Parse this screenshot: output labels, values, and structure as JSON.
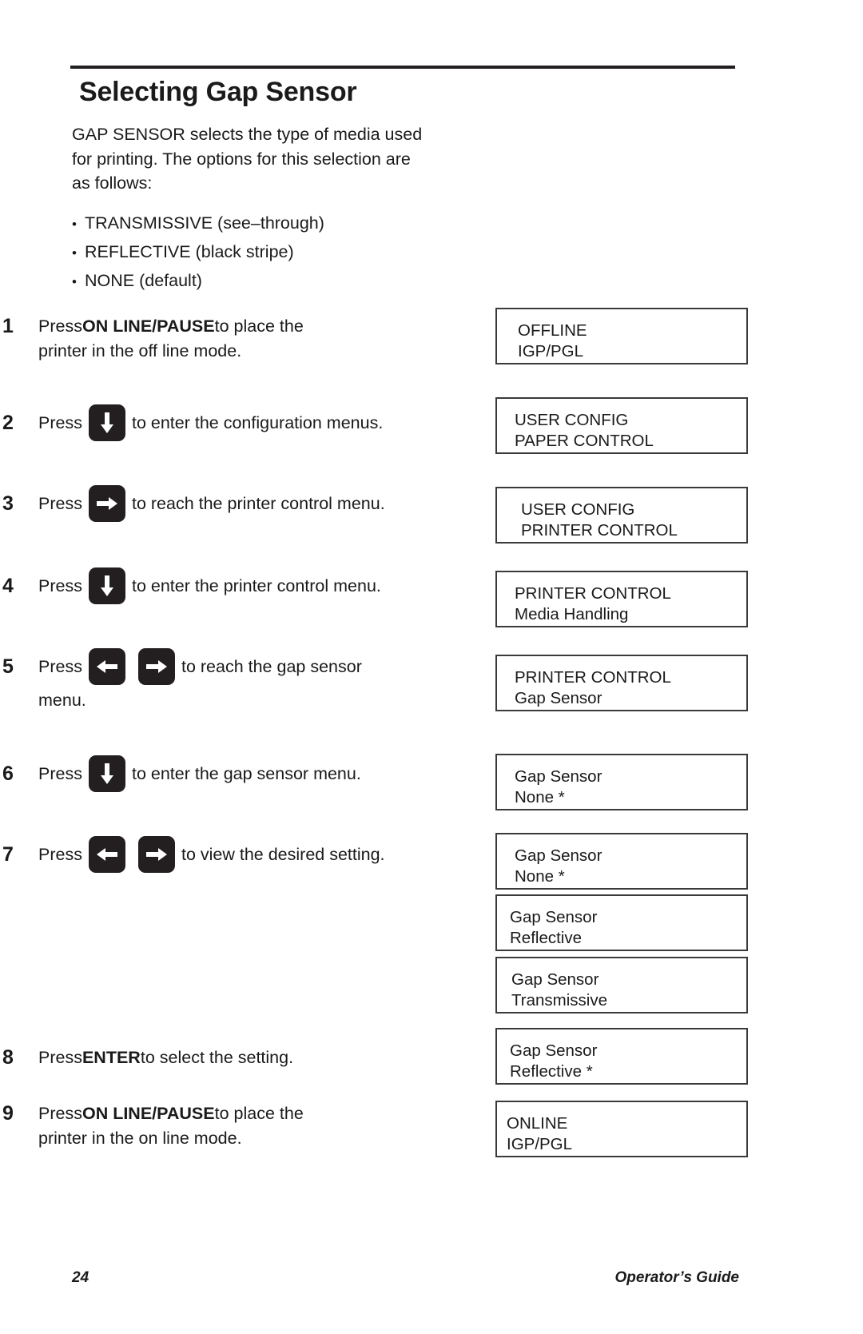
{
  "document": {
    "title": "Selecting Gap Sensor",
    "intro": "GAP SENSOR selects the type of media used for printing. The options for this selection are as follows:",
    "options": [
      {
        "bullet": "•",
        "text": "TRANSMISSIVE (see–through)"
      },
      {
        "bullet": "•",
        "text": "REFLECTIVE (black stripe)"
      },
      {
        "bullet": "•",
        "text": "NONE (default)"
      }
    ]
  },
  "steps": [
    {
      "number": "1",
      "line1_pre": "Press ",
      "line1_bold": "ON LINE/PAUSE",
      "line1_post": " to place the",
      "line2": "printer in the off line mode.",
      "keys": []
    },
    {
      "number": "2",
      "line1_pre": "Press ",
      "line1_post": "to enter the configuration menus.",
      "keys": [
        "arrow-down"
      ]
    },
    {
      "number": "3",
      "line1_pre": "Press ",
      "line1_post": "to reach the printer control menu.",
      "keys": [
        "arrow-right"
      ]
    },
    {
      "number": "4",
      "line1_pre": "Press ",
      "line1_post": "to enter the printer control menu.",
      "keys": [
        "arrow-down"
      ]
    },
    {
      "number": "5",
      "line1_pre": "Press ",
      "line1_post": "to reach the gap sensor",
      "line2": "menu.",
      "keys": [
        "arrow-left",
        "arrow-right"
      ]
    },
    {
      "number": "6",
      "line1_pre": "Press ",
      "line1_post": "to enter the gap sensor menu.",
      "keys": [
        "arrow-down"
      ]
    },
    {
      "number": "7",
      "line1_pre": "Press ",
      "line1_post": "to view the desired setting.",
      "keys": [
        "arrow-left",
        "arrow-right"
      ]
    },
    {
      "number": "8",
      "line1_pre": "Press ",
      "line1_bold": "ENTER",
      "line1_post": " to select the setting.",
      "keys": []
    },
    {
      "number": "9",
      "line1_pre": "Press ",
      "line1_bold": "ON LINE/PAUSE",
      "line1_post": " to place the",
      "line2": "printer in the on line mode.",
      "keys": []
    }
  ],
  "displays": [
    {
      "line1": "OFFLINE",
      "line2": "IGP/PGL"
    },
    {
      "line1": "USER CONFIG",
      "line2": "PAPER CONTROL"
    },
    {
      "line1": "USER CONFIG",
      "line2": "PRINTER CONTROL"
    },
    {
      "line1": "PRINTER CONTROL",
      "line2": "Media Handling"
    },
    {
      "line1": "PRINTER CONTROL",
      "line2": "Gap Sensor"
    },
    {
      "line1": "Gap Sensor",
      "line2": "None *"
    },
    {
      "line1": "Gap Sensor",
      "line2": "None *"
    },
    {
      "line1": "Gap Sensor",
      "line2": "Reflective"
    },
    {
      "line1": "Gap Sensor",
      "line2": "Transmissive"
    },
    {
      "line1": "Gap Sensor",
      "line2": "Reflective *"
    },
    {
      "line1": "ONLINE",
      "line2": "IGP/PGL"
    }
  ],
  "footer": {
    "page_number": "24",
    "guide_label": "Operator’s Guide"
  },
  "colors": {
    "ink": "#1a1a1a",
    "key_fill": "#231f20",
    "box_border": "#3a3a3a",
    "paper": "#ffffff"
  }
}
